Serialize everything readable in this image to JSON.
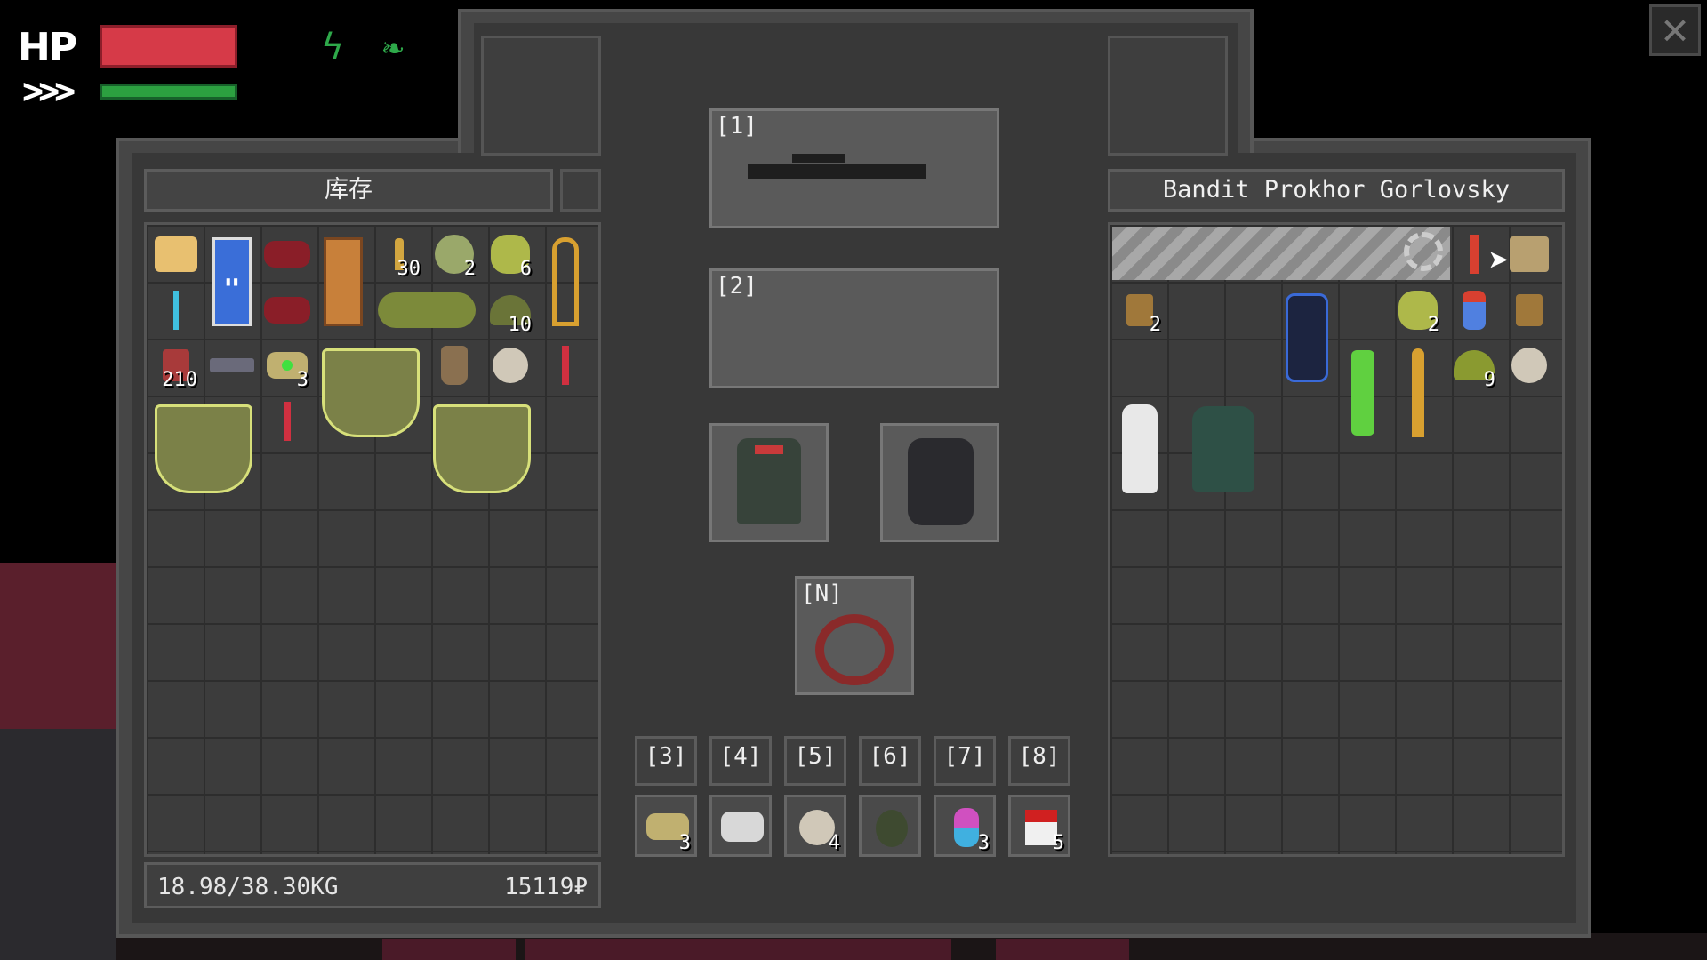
{
  "hud": {
    "hp_label": "HP",
    "stamina_icon": "chevrons-icon",
    "status_icons": [
      "lightning-icon",
      "leaf-icon"
    ],
    "hp_color": "#d63a48",
    "stamina_color": "#2ca040"
  },
  "player_inventory": {
    "title": "库存",
    "weight": "18.98/38.30KG",
    "money": "15119₽",
    "items": [
      {
        "name": "bread",
        "count": ""
      },
      {
        "name": "milk-carton",
        "count": ""
      },
      {
        "name": "sausage",
        "count": ""
      },
      {
        "name": "mre-ration",
        "count": ""
      },
      {
        "name": "rifle-ammo",
        "count": "30"
      },
      {
        "name": "cabbage",
        "count": "2"
      },
      {
        "name": "herb-bundle",
        "count": "6"
      },
      {
        "name": "medkit-ribbon",
        "count": ""
      },
      {
        "name": "syringe-blue",
        "count": ""
      },
      {
        "name": "sausage-2",
        "count": ""
      },
      {
        "name": "herb-pile",
        "count": ""
      },
      {
        "name": "green-helmet",
        "count": "10"
      },
      {
        "name": "shotgun-shells",
        "count": "210"
      },
      {
        "name": "battery",
        "count": ""
      },
      {
        "name": "scanner-device",
        "count": "3"
      },
      {
        "name": "cooking-pot",
        "count": ""
      },
      {
        "name": "sack",
        "count": ""
      },
      {
        "name": "toilet-paper",
        "count": ""
      },
      {
        "name": "syringe-red",
        "count": ""
      },
      {
        "name": "cooking-pot-2",
        "count": ""
      },
      {
        "name": "syringe-red-2",
        "count": ""
      },
      {
        "name": "cooking-pot-3",
        "count": ""
      }
    ]
  },
  "equipment": {
    "slot1_label": "[1]",
    "slot1_item": "sniper-rifle",
    "slot2_label": "[2]",
    "armor_item": "armor-vest",
    "backpack_item": "backpack",
    "neck_label": "[N]",
    "neck_item": "amulet"
  },
  "hotbar": {
    "slots": [
      {
        "label": "[3]",
        "item": "scanner-device",
        "count": "3"
      },
      {
        "label": "[4]",
        "item": "detector",
        "count": ""
      },
      {
        "label": "[5]",
        "item": "toilet-paper",
        "count": "4"
      },
      {
        "label": "[6]",
        "item": "grenade",
        "count": ""
      },
      {
        "label": "[7]",
        "item": "pills",
        "count": "3"
      },
      {
        "label": "[8]",
        "item": "cigarettes",
        "count": "5"
      }
    ]
  },
  "loot": {
    "title": "Bandit Prokhor Gorlovsky",
    "items": [
      {
        "name": "shotgun-shells",
        "count": "2"
      },
      {
        "name": "canister",
        "count": ""
      },
      {
        "name": "cabbage",
        "count": "2"
      },
      {
        "name": "water-bottle",
        "count": ""
      },
      {
        "name": "shotgun-shells-2",
        "count": ""
      },
      {
        "name": "green-helmet",
        "count": "9"
      },
      {
        "name": "toilet-paper",
        "count": ""
      },
      {
        "name": "spray-can",
        "count": ""
      },
      {
        "name": "knife",
        "count": ""
      },
      {
        "name": "white-bottle",
        "count": ""
      },
      {
        "name": "armor-vest",
        "count": ""
      },
      {
        "name": "red-flare",
        "count": ""
      },
      {
        "name": "map-scroll",
        "count": ""
      }
    ]
  }
}
